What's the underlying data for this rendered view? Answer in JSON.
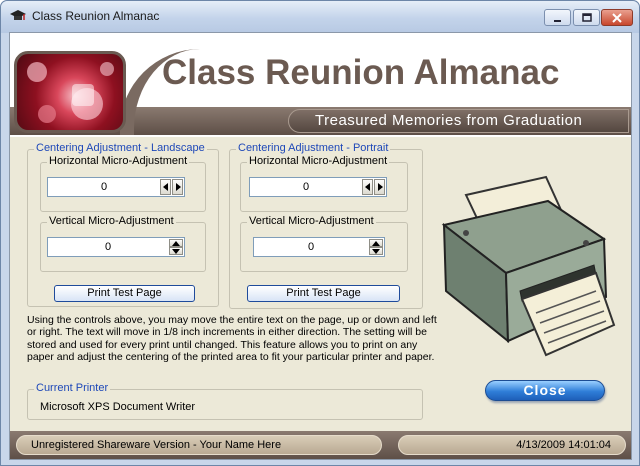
{
  "window": {
    "title": "Class Reunion Almanac"
  },
  "banner": {
    "title": "Class Reunion Almanac",
    "subtitle": "Treasured Memories from Graduation"
  },
  "landscape": {
    "group_label": "Centering Adjustment - Landscape",
    "horizontal": {
      "label": "Horizontal Micro-Adjustment",
      "value": "0"
    },
    "vertical": {
      "label": "Vertical Micro-Adjustment",
      "value": "0"
    },
    "print_button": "Print Test Page"
  },
  "portrait": {
    "group_label": "Centering Adjustment - Portrait",
    "horizontal": {
      "label": "Horizontal Micro-Adjustment",
      "value": "0"
    },
    "vertical": {
      "label": "Vertical Micro-Adjustment",
      "value": "0"
    },
    "print_button": "Print Test Page"
  },
  "info_text": "Using the controls above, you may move the entire text on the page, up or down and left or right. The text will move in 1/8 inch increments in either direction. The setting will be stored and used for every print until changed.  This feature allows you to print on any paper and adjust the centering of the printed area to fit your particular printer and paper.",
  "current_printer": {
    "label": "Current Printer",
    "value": "Microsoft XPS Document Writer"
  },
  "close_button": "Close",
  "statusbar": {
    "left": "Unregistered Shareware Version - Your Name Here",
    "right": "4/13/2009 14:01:04"
  },
  "colors": {
    "accent_blue": "#1e48b8",
    "banner_brown": "#6b5a51",
    "close_button": "#2f7ed8"
  }
}
